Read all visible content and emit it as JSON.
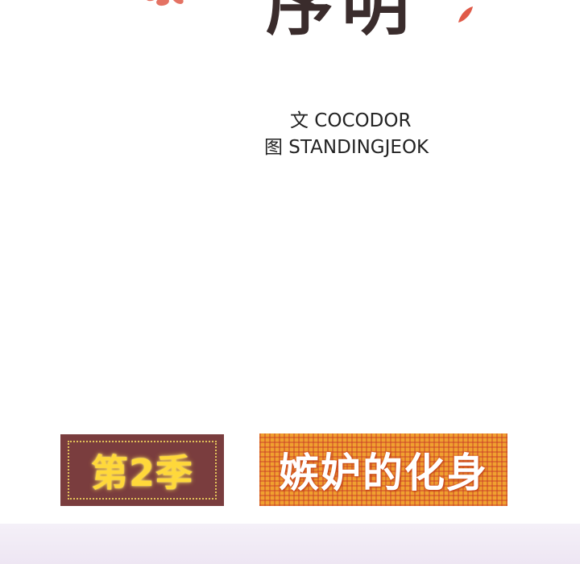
{
  "title": {
    "fragment": "序明"
  },
  "credits": {
    "writer": "文  COCODOR",
    "artist": "图  STANDINGJEOK"
  },
  "season_badge": {
    "label": "第2季"
  },
  "chapter_badge": {
    "title": "嫉妒的化身"
  },
  "colors": {
    "season_bg": "#7a3d3e",
    "season_text": "#ffd83a",
    "chapter_bg": "#f0a030",
    "chapter_text": "#ffffff",
    "flower": "#e04a3a"
  }
}
